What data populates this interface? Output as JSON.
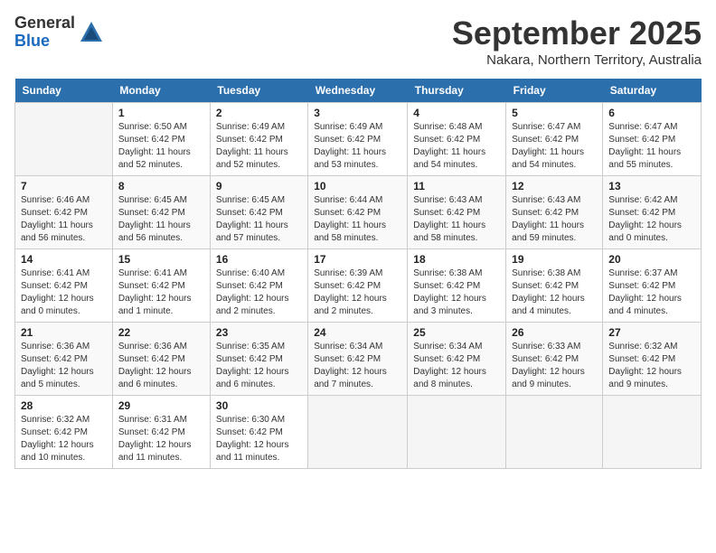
{
  "logo": {
    "general": "General",
    "blue": "Blue"
  },
  "title": {
    "month": "September 2025",
    "location": "Nakara, Northern Territory, Australia"
  },
  "weekdays": [
    "Sunday",
    "Monday",
    "Tuesday",
    "Wednesday",
    "Thursday",
    "Friday",
    "Saturday"
  ],
  "weeks": [
    [
      {
        "day": "",
        "info": ""
      },
      {
        "day": "1",
        "info": "Sunrise: 6:50 AM\nSunset: 6:42 PM\nDaylight: 11 hours\nand 52 minutes."
      },
      {
        "day": "2",
        "info": "Sunrise: 6:49 AM\nSunset: 6:42 PM\nDaylight: 11 hours\nand 52 minutes."
      },
      {
        "day": "3",
        "info": "Sunrise: 6:49 AM\nSunset: 6:42 PM\nDaylight: 11 hours\nand 53 minutes."
      },
      {
        "day": "4",
        "info": "Sunrise: 6:48 AM\nSunset: 6:42 PM\nDaylight: 11 hours\nand 54 minutes."
      },
      {
        "day": "5",
        "info": "Sunrise: 6:47 AM\nSunset: 6:42 PM\nDaylight: 11 hours\nand 54 minutes."
      },
      {
        "day": "6",
        "info": "Sunrise: 6:47 AM\nSunset: 6:42 PM\nDaylight: 11 hours\nand 55 minutes."
      }
    ],
    [
      {
        "day": "7",
        "info": "Sunrise: 6:46 AM\nSunset: 6:42 PM\nDaylight: 11 hours\nand 56 minutes."
      },
      {
        "day": "8",
        "info": "Sunrise: 6:45 AM\nSunset: 6:42 PM\nDaylight: 11 hours\nand 56 minutes."
      },
      {
        "day": "9",
        "info": "Sunrise: 6:45 AM\nSunset: 6:42 PM\nDaylight: 11 hours\nand 57 minutes."
      },
      {
        "day": "10",
        "info": "Sunrise: 6:44 AM\nSunset: 6:42 PM\nDaylight: 11 hours\nand 58 minutes."
      },
      {
        "day": "11",
        "info": "Sunrise: 6:43 AM\nSunset: 6:42 PM\nDaylight: 11 hours\nand 58 minutes."
      },
      {
        "day": "12",
        "info": "Sunrise: 6:43 AM\nSunset: 6:42 PM\nDaylight: 11 hours\nand 59 minutes."
      },
      {
        "day": "13",
        "info": "Sunrise: 6:42 AM\nSunset: 6:42 PM\nDaylight: 12 hours\nand 0 minutes."
      }
    ],
    [
      {
        "day": "14",
        "info": "Sunrise: 6:41 AM\nSunset: 6:42 PM\nDaylight: 12 hours\nand 0 minutes."
      },
      {
        "day": "15",
        "info": "Sunrise: 6:41 AM\nSunset: 6:42 PM\nDaylight: 12 hours\nand 1 minute."
      },
      {
        "day": "16",
        "info": "Sunrise: 6:40 AM\nSunset: 6:42 PM\nDaylight: 12 hours\nand 2 minutes."
      },
      {
        "day": "17",
        "info": "Sunrise: 6:39 AM\nSunset: 6:42 PM\nDaylight: 12 hours\nand 2 minutes."
      },
      {
        "day": "18",
        "info": "Sunrise: 6:38 AM\nSunset: 6:42 PM\nDaylight: 12 hours\nand 3 minutes."
      },
      {
        "day": "19",
        "info": "Sunrise: 6:38 AM\nSunset: 6:42 PM\nDaylight: 12 hours\nand 4 minutes."
      },
      {
        "day": "20",
        "info": "Sunrise: 6:37 AM\nSunset: 6:42 PM\nDaylight: 12 hours\nand 4 minutes."
      }
    ],
    [
      {
        "day": "21",
        "info": "Sunrise: 6:36 AM\nSunset: 6:42 PM\nDaylight: 12 hours\nand 5 minutes."
      },
      {
        "day": "22",
        "info": "Sunrise: 6:36 AM\nSunset: 6:42 PM\nDaylight: 12 hours\nand 6 minutes."
      },
      {
        "day": "23",
        "info": "Sunrise: 6:35 AM\nSunset: 6:42 PM\nDaylight: 12 hours\nand 6 minutes."
      },
      {
        "day": "24",
        "info": "Sunrise: 6:34 AM\nSunset: 6:42 PM\nDaylight: 12 hours\nand 7 minutes."
      },
      {
        "day": "25",
        "info": "Sunrise: 6:34 AM\nSunset: 6:42 PM\nDaylight: 12 hours\nand 8 minutes."
      },
      {
        "day": "26",
        "info": "Sunrise: 6:33 AM\nSunset: 6:42 PM\nDaylight: 12 hours\nand 9 minutes."
      },
      {
        "day": "27",
        "info": "Sunrise: 6:32 AM\nSunset: 6:42 PM\nDaylight: 12 hours\nand 9 minutes."
      }
    ],
    [
      {
        "day": "28",
        "info": "Sunrise: 6:32 AM\nSunset: 6:42 PM\nDaylight: 12 hours\nand 10 minutes."
      },
      {
        "day": "29",
        "info": "Sunrise: 6:31 AM\nSunset: 6:42 PM\nDaylight: 12 hours\nand 11 minutes."
      },
      {
        "day": "30",
        "info": "Sunrise: 6:30 AM\nSunset: 6:42 PM\nDaylight: 12 hours\nand 11 minutes."
      },
      {
        "day": "",
        "info": ""
      },
      {
        "day": "",
        "info": ""
      },
      {
        "day": "",
        "info": ""
      },
      {
        "day": "",
        "info": ""
      }
    ]
  ]
}
